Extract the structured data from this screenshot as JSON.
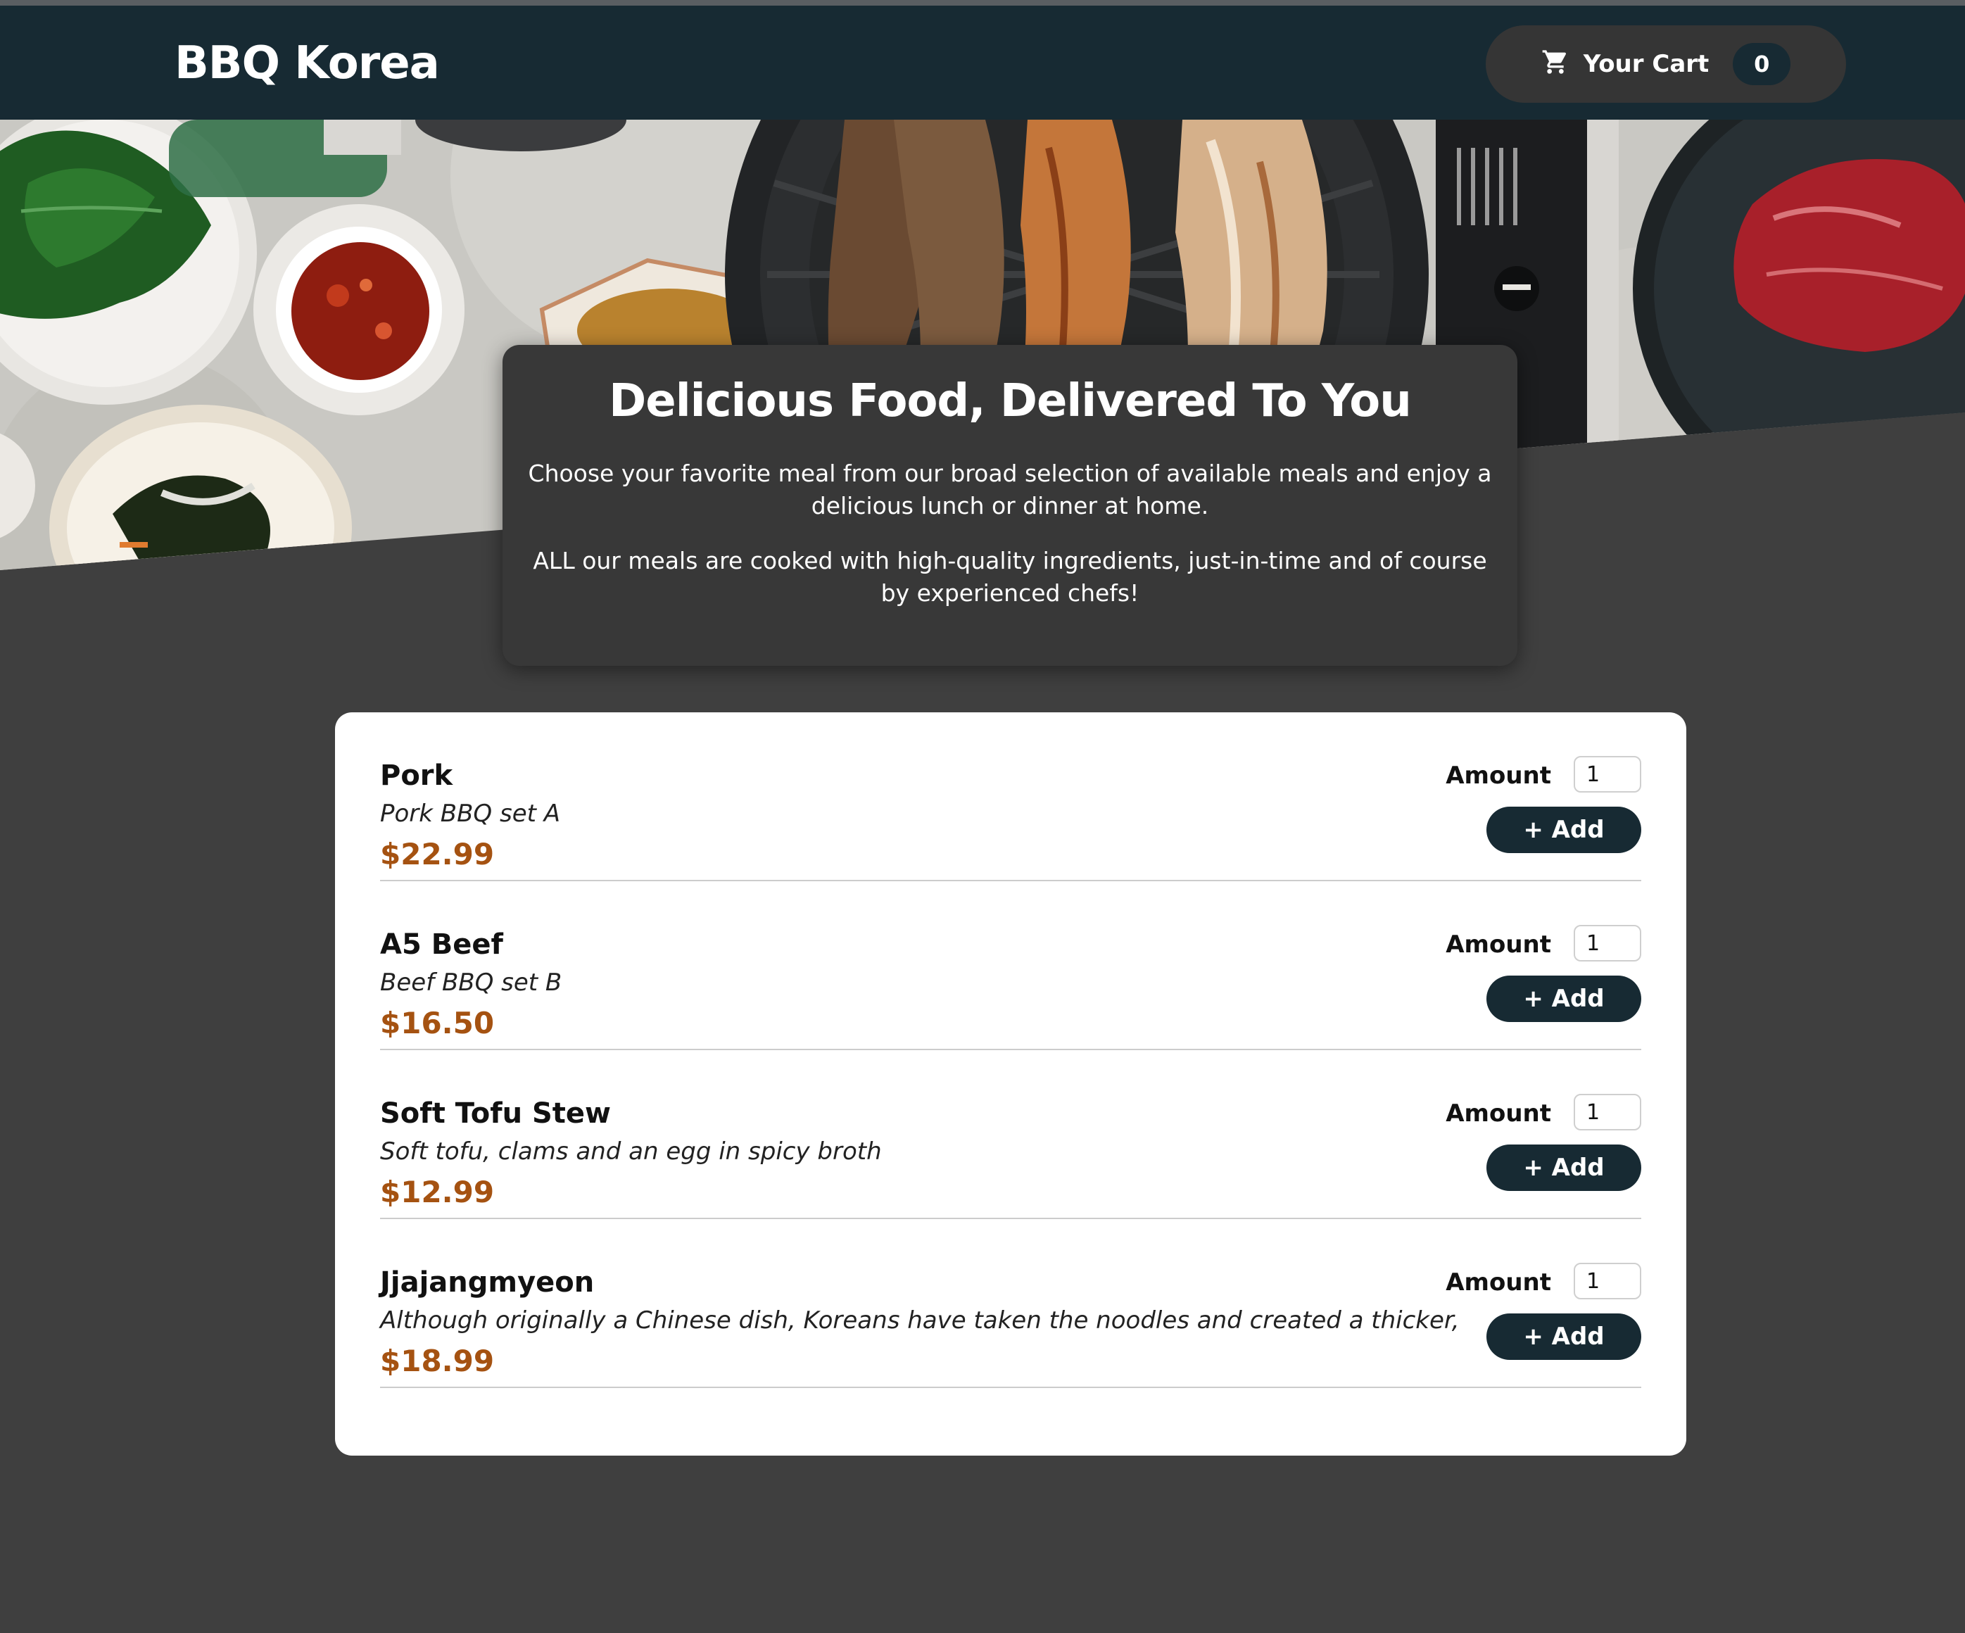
{
  "header": {
    "title": "BBQ Korea",
    "cart": {
      "label": "Your Cart",
      "count": "0",
      "icon": "cart-icon"
    }
  },
  "summary": {
    "heading": "Delicious Food, Delivered To You",
    "paragraph1": "Choose your favorite meal from our broad selection of available meals and enjoy a delicious lunch or dinner at home.",
    "paragraph2": "ALL our meals are cooked with high-quality ingredients, just-in-time and of course by experienced chefs!"
  },
  "meals": [
    {
      "name": "Pork",
      "description": "Pork BBQ set A",
      "price": "$22.99",
      "amount_label": "Amount",
      "amount": "1",
      "add_label": "+ Add"
    },
    {
      "name": "A5 Beef",
      "description": "Beef BBQ set B",
      "price": "$16.50",
      "amount_label": "Amount",
      "amount": "1",
      "add_label": "+ Add"
    },
    {
      "name": "Soft Tofu Stew",
      "description": "Soft tofu, clams and an egg in spicy broth",
      "price": "$12.99",
      "amount_label": "Amount",
      "amount": "1",
      "add_label": "+ Add"
    },
    {
      "name": "Jjajangmyeon",
      "description": "Although originally a Chinese dish, Koreans have taken the noodles and created a thicker,",
      "price": "$18.99",
      "amount_label": "Amount",
      "amount": "1",
      "add_label": "+ Add"
    }
  ],
  "colors": {
    "header_bg": "#172a33",
    "page_bg": "#3f3f3f",
    "price": "#a55211",
    "button_bg": "#172a33"
  }
}
